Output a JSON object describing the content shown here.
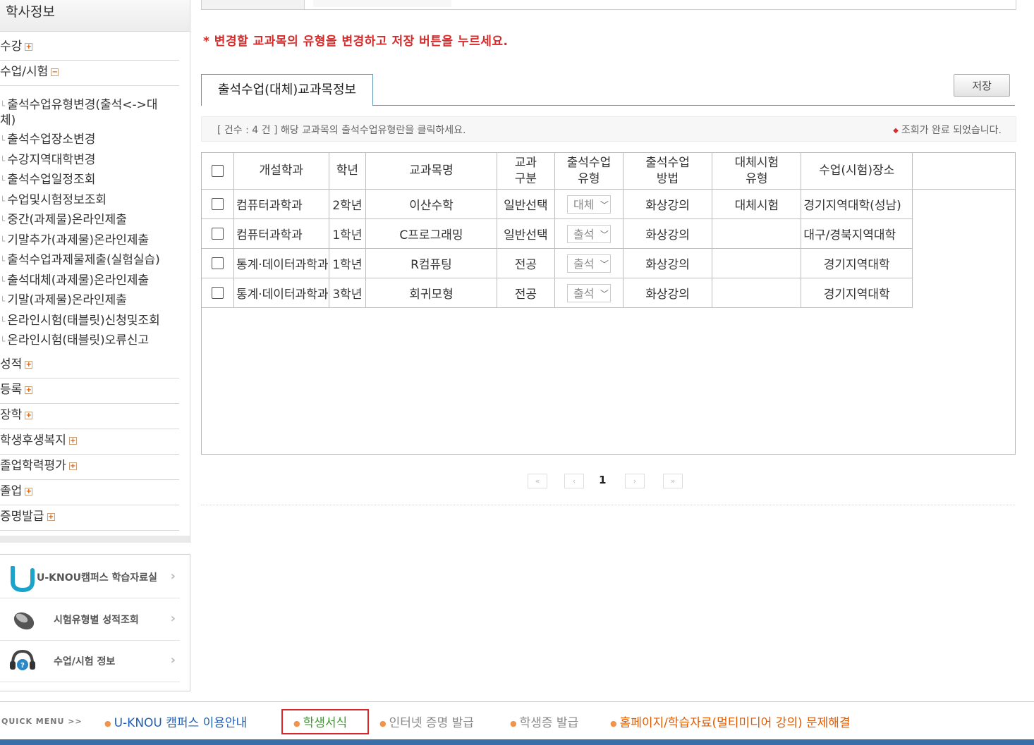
{
  "sidebar": {
    "title": "학사정보",
    "groups_top": [
      {
        "label": "수강",
        "toggle": "+"
      },
      {
        "label": "수업/시험",
        "toggle": "−"
      }
    ],
    "sub_items": [
      "출석수업유형변경(출석<->대",
      "출석수업장소변경",
      "수강지역대학변경",
      "출석수업일정조회",
      "수업및시험정보조회",
      "중간(과제물)온라인제출",
      "기말추가(과제물)온라인제출",
      "출석수업과제물제출(실험실습)",
      "출석대체(과제물)온라인제출",
      "기말(과제물)온라인제출",
      "온라인시험(태블릿)신청및조회",
      "온라인시험(태블릿)오류신고"
    ],
    "sub_item_wrap": "체)",
    "groups_bottom": [
      {
        "label": "성적",
        "toggle": "+"
      },
      {
        "label": "등록",
        "toggle": "+"
      },
      {
        "label": "장학",
        "toggle": "+"
      },
      {
        "label": "학생후생복지",
        "toggle": "+"
      },
      {
        "label": "졸업학력평가",
        "toggle": "+"
      },
      {
        "label": "졸업",
        "toggle": "+"
      },
      {
        "label": "증명발급",
        "toggle": "+"
      }
    ]
  },
  "quick_box": {
    "items": [
      {
        "label": "U-KNOU캠퍼스 학습자료실",
        "icon": "u-knou-logo-icon"
      },
      {
        "label": "시험유형별 성적조회",
        "icon": "mouse-icon"
      },
      {
        "label": "수업/시험 정보",
        "icon": "headset-icon"
      }
    ],
    "chevron": "›"
  },
  "notice": "* 변경할 교과목의 유형을 변경하고 저장 버튼을 누르세요.",
  "tab_label": "출석수업(대체)교과목정보",
  "save_label": "저장",
  "info": {
    "left": "[ 건수 : 4 건 ] 해당 교과목의 출석수업유형란을 클릭하세요.",
    "right": "조회가 완료 되었습니다.",
    "dot": "◆"
  },
  "table": {
    "headers": {
      "dept": "개설학과",
      "year": "학년",
      "course": "교과목명",
      "category_1": "교과",
      "category_2": "구분",
      "att_type_1": "출석수업",
      "att_type_2": "유형",
      "att_method_1": "출석수업",
      "att_method_2": "방법",
      "alt_exam_1": "대체시험",
      "alt_exam_2": "유형",
      "place": "수업(시험)장소"
    },
    "rows": [
      {
        "dept": "컴퓨터과학과",
        "year": "2학년",
        "course": "이산수학",
        "category": "일반선택",
        "att_type": "대체",
        "att_method": "화상강의",
        "alt_exam": "대체시험",
        "place": "경기지역대학(성남)"
      },
      {
        "dept": "컴퓨터과학과",
        "year": "1학년",
        "course": "C프로그래밍",
        "category": "일반선택",
        "att_type": "출석",
        "att_method": "화상강의",
        "alt_exam": "",
        "place": "대구/경북지역대학"
      },
      {
        "dept": "통계·데이터과학과",
        "year": "1학년",
        "course": "R컴퓨팅",
        "category": "전공",
        "att_type": "출석",
        "att_method": "화상강의",
        "alt_exam": "",
        "place": "경기지역대학"
      },
      {
        "dept": "통계·데이터과학과",
        "year": "3학년",
        "course": "회귀모형",
        "category": "전공",
        "att_type": "출석",
        "att_method": "화상강의",
        "alt_exam": "",
        "place": "경기지역대학"
      }
    ]
  },
  "pagination": {
    "first": "«",
    "prev": "‹",
    "current": "1",
    "next": "›",
    "last": "»"
  },
  "footer": {
    "quick_label": "QUICK MENU  >>",
    "links": [
      {
        "label": "U-KNOU 캠퍼스 이용안내",
        "color": "#1f5fb8"
      },
      {
        "label": "학생서식",
        "color": "#3a9a2c"
      },
      {
        "label": "인터넷 증명 발급",
        "color": "#888888"
      },
      {
        "label": "학생증 발급",
        "color": "#888888"
      },
      {
        "label": "홈페이지/학습자료(멀티미디어 강의) 문제해결",
        "color": "#e25a00"
      }
    ],
    "bullet": "●"
  },
  "colors": {
    "notice_red": "#d62b2b",
    "tab_border": "#5e9ab5",
    "footer_bar": "#3a6ea8",
    "highlight_box": "#d9262c"
  }
}
